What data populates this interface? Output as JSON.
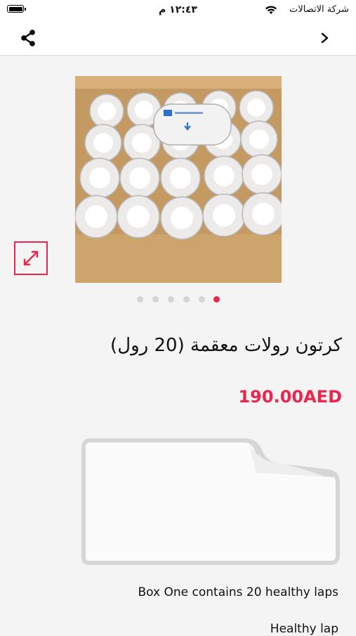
{
  "status_bar": {
    "time": "١٢:٤٣ م",
    "carrier": "شركة الاتصالات",
    "battery_icon": "battery-icon",
    "wifi_icon": "wifi-icon"
  },
  "nav": {
    "share_icon": "share-icon",
    "back_icon": "chevron-right-icon"
  },
  "product": {
    "image_alt_icon": "product-photo",
    "expand_icon": "expand-arrows-icon",
    "gallery": {
      "count": 6,
      "active_index": 5
    },
    "title": "كرتون رولات معقمة (20 رول)",
    "price": "190.00AED",
    "description_placeholder_icon": "document-placeholder-icon",
    "description_lines": [
      "Box One contains 20 healthy laps",
      "Healthy lap"
    ]
  },
  "colors": {
    "accent": "#e8274f",
    "background": "#f4f4f4",
    "dot_inactive": "#d4d4d4"
  }
}
